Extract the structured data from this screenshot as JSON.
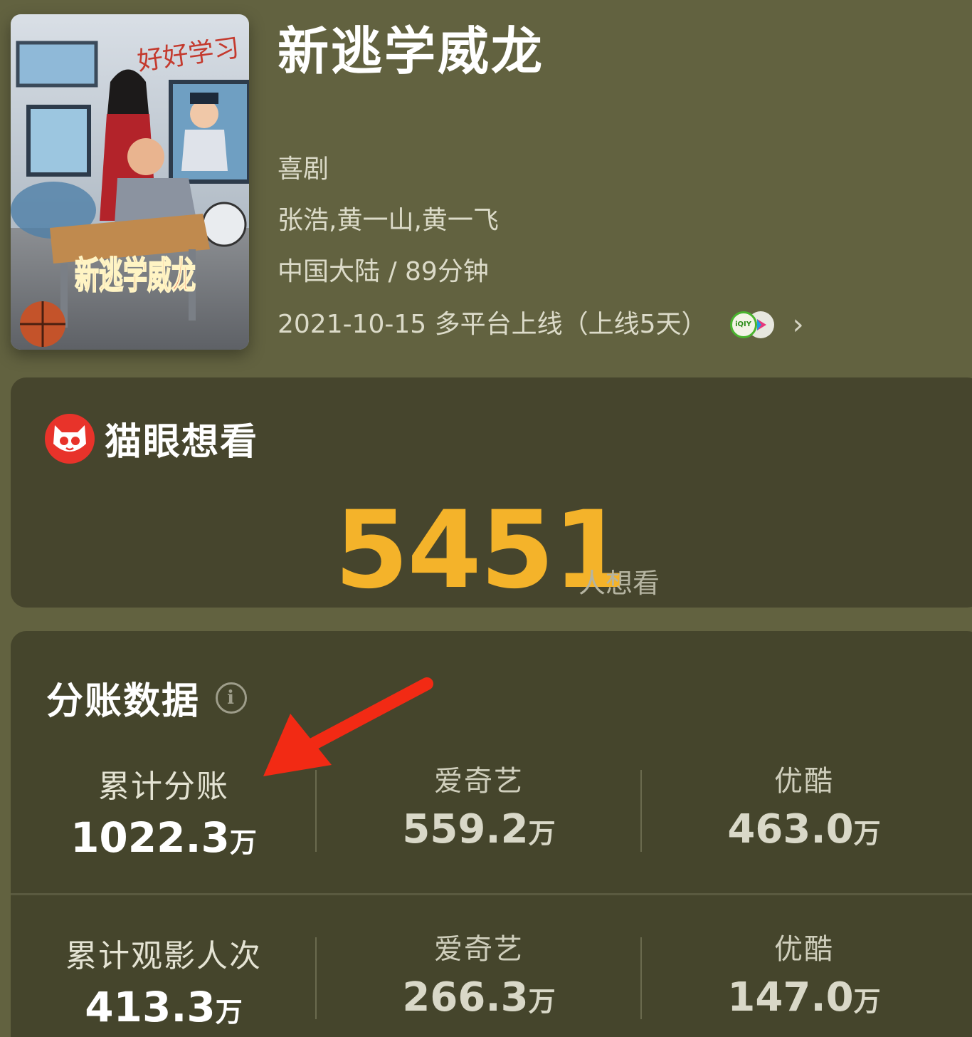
{
  "movie": {
    "title": "新逃学威龙",
    "genre": "喜剧",
    "cast": "张浩,黄一山,黄一飞",
    "region_duration": "中国大陆 / 89分钟",
    "release": "2021-10-15 多平台上线（上线5天）",
    "platform_icons": [
      "iqiyi-icon",
      "youku-icon"
    ],
    "poster": {
      "banner_text": "好好学习",
      "logo_text": "新逃学威龙"
    }
  },
  "want_to_see": {
    "title": "猫眼想看",
    "count": "5451",
    "unit": "人想看",
    "count_color": "#f4b32a"
  },
  "share_data": {
    "title": "分账数据",
    "rows": [
      {
        "main": {
          "label": "累计分账",
          "value": "1022.3",
          "unit": "万"
        },
        "platforms": [
          {
            "label": "爱奇艺",
            "value": "559.2",
            "unit": "万"
          },
          {
            "label": "优酷",
            "value": "463.0",
            "unit": "万"
          }
        ]
      },
      {
        "main": {
          "label": "累计观影人次",
          "value": "413.3",
          "unit": "万"
        },
        "platforms": [
          {
            "label": "爱奇艺",
            "value": "266.3",
            "unit": "万"
          },
          {
            "label": "优酷",
            "value": "147.0",
            "unit": "万"
          }
        ]
      }
    ]
  },
  "annotation": {
    "arrow_color": "#f22a14"
  }
}
